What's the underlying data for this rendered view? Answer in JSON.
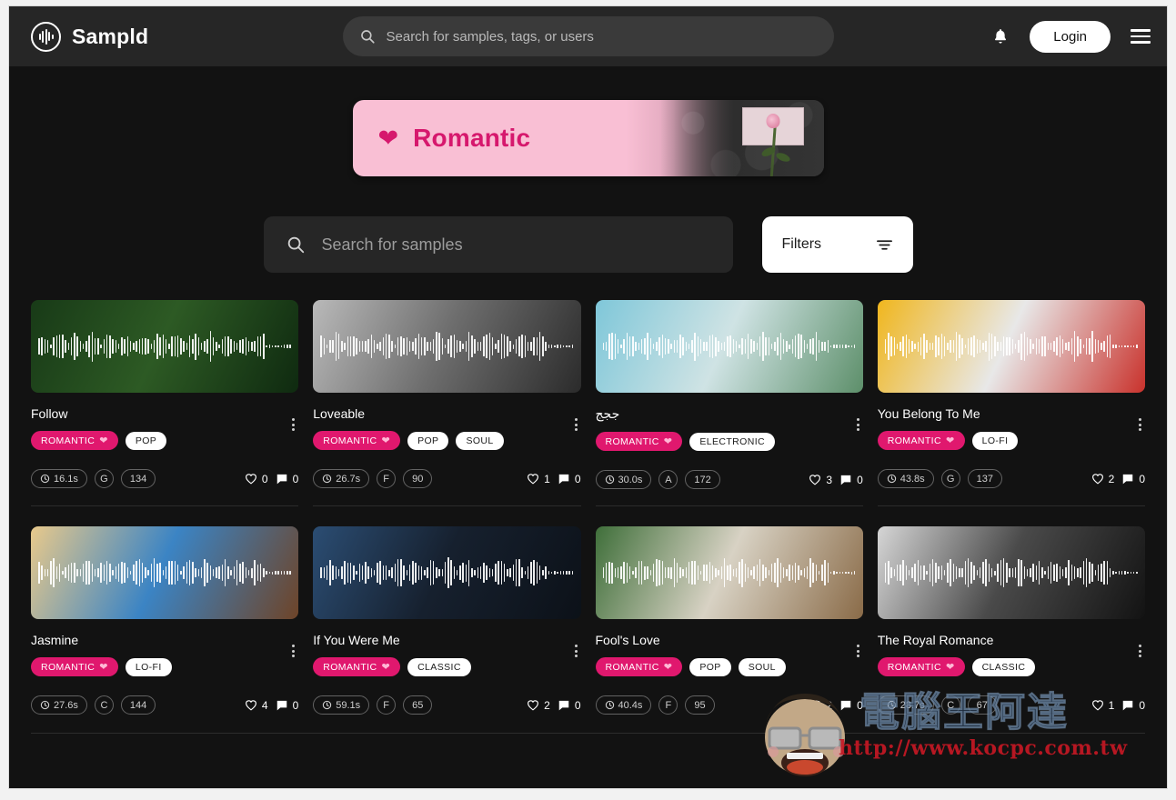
{
  "nav": {
    "brand": "Sampld",
    "brand_icon": "waveform-circle-icon",
    "search_placeholder": "Search for samples, tags, or users",
    "search_icon": "search-icon",
    "bell_icon": "bell-icon",
    "login_label": "Login",
    "menu_icon": "hamburger-menu-icon"
  },
  "banner": {
    "title": "Romantic",
    "heart_icon": "heart-icon",
    "bg_color": "#f9bfd4",
    "text_color": "#d6186d"
  },
  "search": {
    "placeholder": "Search for samples",
    "icon": "search-icon",
    "filters_label": "Filters",
    "filters_icon": "filter-icon"
  },
  "cards": [
    {
      "title": "Follow",
      "tags": [
        {
          "label": "ROMANTIC",
          "type": "romantic"
        },
        {
          "label": "POP",
          "type": "plain"
        }
      ],
      "duration": "16.1s",
      "key": "G",
      "bpm": "134",
      "likes": "0",
      "comments": "0",
      "art_colors": [
        "#183a17",
        "#2d5a24",
        "#0f2a10"
      ]
    },
    {
      "title": "Loveable",
      "tags": [
        {
          "label": "ROMANTIC",
          "type": "romantic"
        },
        {
          "label": "POP",
          "type": "plain"
        },
        {
          "label": "SOUL",
          "type": "plain"
        }
      ],
      "duration": "26.7s",
      "key": "F",
      "bpm": "90",
      "likes": "1",
      "comments": "0",
      "art_colors": [
        "#b9b9b9",
        "#6e6e6e",
        "#2b2b2b"
      ]
    },
    {
      "title": "ججج",
      "tags": [
        {
          "label": "ROMANTIC",
          "type": "romantic"
        },
        {
          "label": "ELECTRONIC",
          "type": "plain"
        }
      ],
      "duration": "30.0s",
      "key": "A",
      "bpm": "172",
      "likes": "3",
      "comments": "0",
      "art_colors": [
        "#7fc7d9",
        "#cfe3e4",
        "#5d8f6a"
      ]
    },
    {
      "title": "You Belong To Me",
      "tags": [
        {
          "label": "ROMANTIC",
          "type": "romantic"
        },
        {
          "label": "LO-FI",
          "type": "plain"
        }
      ],
      "duration": "43.8s",
      "key": "G",
      "bpm": "137",
      "likes": "2",
      "comments": "0",
      "art_colors": [
        "#f0b61d",
        "#e8e8e8",
        "#c9322c"
      ]
    },
    {
      "title": "Jasmine",
      "tags": [
        {
          "label": "ROMANTIC",
          "type": "romantic"
        },
        {
          "label": "LO-FI",
          "type": "plain"
        }
      ],
      "duration": "27.6s",
      "key": "C",
      "bpm": "144",
      "likes": "4",
      "comments": "0",
      "art_colors": [
        "#e8c98b",
        "#3b84c4",
        "#6e4428"
      ]
    },
    {
      "title": "If You Were Me",
      "tags": [
        {
          "label": "ROMANTIC",
          "type": "romantic"
        },
        {
          "label": "CLASSIC",
          "type": "plain"
        }
      ],
      "duration": "59.1s",
      "key": "F",
      "bpm": "65",
      "likes": "2",
      "comments": "0",
      "art_colors": [
        "#2b4d73",
        "#16202e",
        "#0c1118"
      ]
    },
    {
      "title": "Fool's Love",
      "tags": [
        {
          "label": "ROMANTIC",
          "type": "romantic"
        },
        {
          "label": "POP",
          "type": "plain"
        },
        {
          "label": "SOUL",
          "type": "plain"
        }
      ],
      "duration": "40.4s",
      "key": "F",
      "bpm": "95",
      "likes": "2",
      "comments": "0",
      "art_colors": [
        "#3f6f3a",
        "#d8d2c4",
        "#8a6b48"
      ]
    },
    {
      "title": "The Royal Romance",
      "tags": [
        {
          "label": "ROMANTIC",
          "type": "romantic"
        },
        {
          "label": "CLASSIC",
          "type": "plain"
        }
      ],
      "duration": "28.7s",
      "key": "C",
      "bpm": "67",
      "likes": "1",
      "comments": "0",
      "art_colors": [
        "#d6d6d6",
        "#4a4a4a",
        "#131313"
      ]
    }
  ],
  "watermark": {
    "cjk": "電腦王阿達",
    "url": "http://www.kocpc.com.tw"
  }
}
